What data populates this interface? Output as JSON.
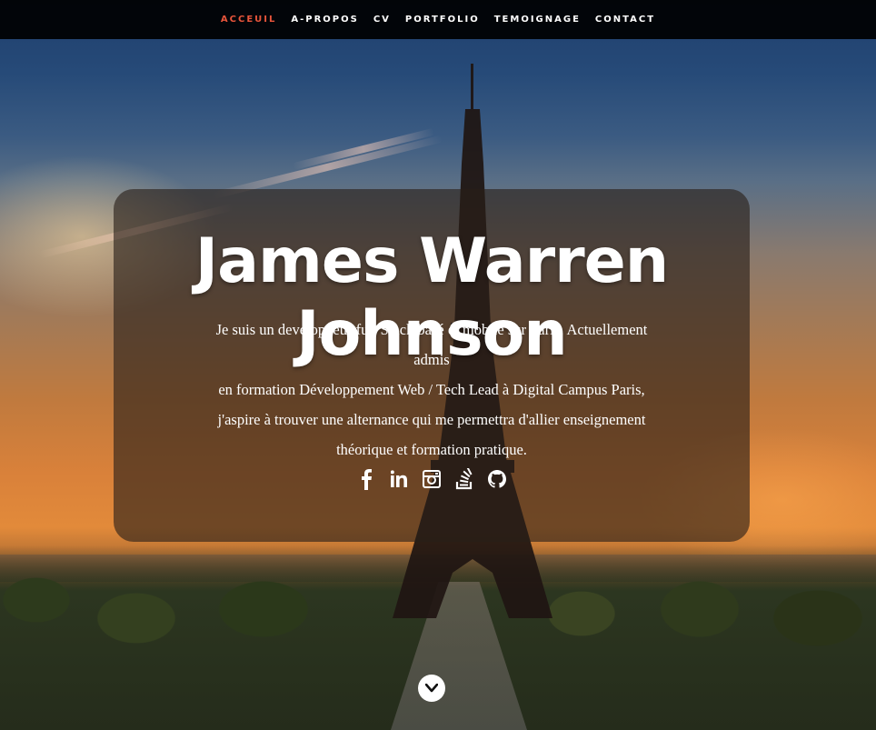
{
  "nav": {
    "items": [
      {
        "label": "ACCEUIL",
        "active": true
      },
      {
        "label": "A-PROPOS",
        "active": false
      },
      {
        "label": "CV",
        "active": false
      },
      {
        "label": "PORTFOLIO",
        "active": false
      },
      {
        "label": "TEMOIGNAGE",
        "active": false
      },
      {
        "label": "CONTACT",
        "active": false
      }
    ],
    "active_color": "#e8553b"
  },
  "hero": {
    "name": "James Warren Johnson",
    "bio_lines": [
      "Je suis un developpeur full Stack basé et mobile sur Paris. Actuellement admis",
      "en formation Développement Web / Tech Lead à Digital Campus Paris,",
      "j'aspire à trouver une alternance qui me permettra d'allier enseignement",
      "théorique et formation pratique."
    ],
    "socials": [
      "facebook-icon",
      "linkedin-icon",
      "instagram-icon",
      "stackoverflow-icon",
      "github-icon"
    ]
  },
  "scroll_button": {
    "icon": "chevron-down-icon"
  }
}
